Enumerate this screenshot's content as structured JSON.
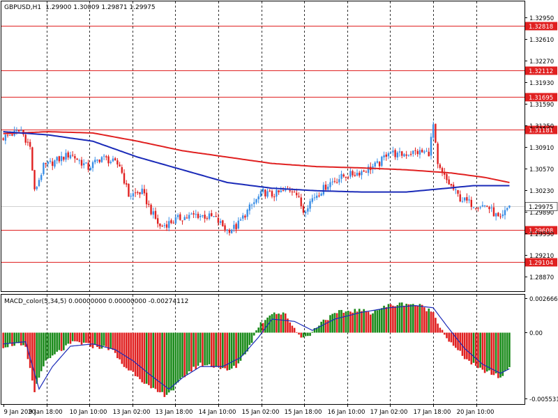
{
  "header": {
    "symbol": "GBPUSD,H1",
    "ohlc": "1.29900 1.30009 1.29871 1.29975"
  },
  "colors": {
    "bull": "#3a8ee6",
    "bear": "#e02020",
    "ma_slow": "#e02020",
    "ma_fast": "#1a2ab8",
    "hline": "#e02020",
    "macd_up": "#1a8a1a",
    "macd_down": "#e02020",
    "signal": "#1a2ab8",
    "grid": "#000000"
  },
  "price_axis": {
    "min": 1.2866,
    "max": 1.3318,
    "ticks": [
      "1.32950",
      "1.32610",
      "1.32270",
      "1.31930",
      "1.31590",
      "1.31250",
      "1.30910",
      "1.30570",
      "1.30230",
      "1.29890",
      "1.29550",
      "1.29210",
      "1.28870"
    ],
    "current_price": "1.29975",
    "horizontal_levels": [
      "1.32818",
      "1.32112",
      "1.31695",
      "1.31181",
      "1.29608",
      "1.29104"
    ]
  },
  "macd": {
    "title": "MACD_color(5,34,5) 0.00000000 0.00000000 -0.00274112",
    "min": -0.0062,
    "max": 0.0033,
    "ticks": [
      "0.0026667",
      "0.00",
      "-0.005531"
    ]
  },
  "time_labels": [
    "9 Jan 2020",
    "9 Jan 18:00",
    "10 Jan 10:00",
    "13 Jan 02:00",
    "13 Jan 18:00",
    "14 Jan 10:00",
    "15 Jan 02:00",
    "15 Jan 18:00",
    "16 Jan 10:00",
    "17 Jan 02:00",
    "17 Jan 18:00",
    "20 Jan 10:00"
  ],
  "chart_data": {
    "type": "candlestick",
    "symbol": "GBPUSD",
    "timeframe": "H1",
    "close_anchors": [
      [
        0,
        1.3106
      ],
      [
        8,
        1.3117
      ],
      [
        12,
        1.309
      ],
      [
        14,
        1.302
      ],
      [
        18,
        1.306
      ],
      [
        30,
        1.308
      ],
      [
        38,
        1.3058
      ],
      [
        44,
        1.3075
      ],
      [
        52,
        1.3062
      ],
      [
        56,
        1.3015
      ],
      [
        62,
        1.302
      ],
      [
        66,
        1.299
      ],
      [
        70,
        1.2965
      ],
      [
        78,
        1.2978
      ],
      [
        86,
        1.2984
      ],
      [
        94,
        1.298
      ],
      [
        100,
        1.296
      ],
      [
        104,
        1.2965
      ],
      [
        110,
        1.2995
      ],
      [
        116,
        1.302
      ],
      [
        120,
        1.3015
      ],
      [
        126,
        1.3022
      ],
      [
        130,
        1.3025
      ],
      [
        134,
        1.299
      ],
      [
        138,
        1.301
      ],
      [
        146,
        1.3035
      ],
      [
        152,
        1.3045
      ],
      [
        158,
        1.305
      ],
      [
        162,
        1.3055
      ],
      [
        168,
        1.3065
      ],
      [
        172,
        1.3085
      ],
      [
        176,
        1.3078
      ],
      [
        184,
        1.3083
      ],
      [
        190,
        1.3082
      ],
      [
        192,
        1.3125
      ],
      [
        194,
        1.306
      ],
      [
        198,
        1.3038
      ],
      [
        204,
        1.301
      ],
      [
        210,
        1.3
      ],
      [
        216,
        1.2998
      ],
      [
        222,
        1.2975
      ],
      [
        226,
        1.3
      ]
    ],
    "ma_slow_anchors": [
      [
        0,
        1.3112
      ],
      [
        20,
        1.3115
      ],
      [
        40,
        1.3113
      ],
      [
        60,
        1.31
      ],
      [
        80,
        1.3085
      ],
      [
        100,
        1.3075
      ],
      [
        120,
        1.3065
      ],
      [
        140,
        1.306
      ],
      [
        160,
        1.3058
      ],
      [
        180,
        1.3055
      ],
      [
        200,
        1.305
      ],
      [
        215,
        1.3043
      ],
      [
        226,
        1.3035
      ]
    ],
    "ma_fast_anchors": [
      [
        0,
        1.3115
      ],
      [
        20,
        1.311
      ],
      [
        40,
        1.31
      ],
      [
        60,
        1.3075
      ],
      [
        80,
        1.3055
      ],
      [
        100,
        1.3035
      ],
      [
        120,
        1.3026
      ],
      [
        140,
        1.3022
      ],
      [
        160,
        1.302
      ],
      [
        180,
        1.302
      ],
      [
        195,
        1.3025
      ],
      [
        210,
        1.303
      ],
      [
        226,
        1.303
      ]
    ],
    "macd_anchors": [
      [
        0,
        -0.0012
      ],
      [
        6,
        -0.001
      ],
      [
        10,
        -0.0014
      ],
      [
        14,
        -0.0052
      ],
      [
        18,
        -0.0028
      ],
      [
        24,
        -0.0018
      ],
      [
        32,
        -0.0008
      ],
      [
        40,
        -0.0012
      ],
      [
        48,
        -0.0014
      ],
      [
        54,
        -0.003
      ],
      [
        60,
        -0.0038
      ],
      [
        66,
        -0.005
      ],
      [
        72,
        -0.0055
      ],
      [
        76,
        -0.005
      ],
      [
        82,
        -0.0036
      ],
      [
        88,
        -0.0028
      ],
      [
        96,
        -0.003
      ],
      [
        100,
        -0.0034
      ],
      [
        104,
        -0.003
      ],
      [
        110,
        -0.0012
      ],
      [
        114,
        0.0006
      ],
      [
        120,
        0.0018
      ],
      [
        126,
        0.0016
      ],
      [
        132,
        -0.0002
      ],
      [
        136,
        -0.0004
      ],
      [
        142,
        0.001
      ],
      [
        150,
        0.0018
      ],
      [
        158,
        0.002
      ],
      [
        164,
        0.0018
      ],
      [
        172,
        0.0024
      ],
      [
        180,
        0.0026
      ],
      [
        186,
        0.0024
      ],
      [
        192,
        0.0018
      ],
      [
        196,
        0.0002
      ],
      [
        200,
        -0.001
      ],
      [
        206,
        -0.0022
      ],
      [
        212,
        -0.0032
      ],
      [
        218,
        -0.0036
      ],
      [
        222,
        -0.004
      ],
      [
        226,
        -0.003
      ]
    ],
    "signal_anchors": [
      [
        0,
        -0.001
      ],
      [
        10,
        -0.0008
      ],
      [
        16,
        -0.005
      ],
      [
        22,
        -0.003
      ],
      [
        30,
        -0.0012
      ],
      [
        40,
        -0.001
      ],
      [
        50,
        -0.0015
      ],
      [
        58,
        -0.0025
      ],
      [
        66,
        -0.0038
      ],
      [
        74,
        -0.005
      ],
      [
        80,
        -0.004
      ],
      [
        88,
        -0.003
      ],
      [
        98,
        -0.003
      ],
      [
        106,
        -0.0022
      ],
      [
        114,
        -0.0004
      ],
      [
        120,
        0.0012
      ],
      [
        130,
        0.001
      ],
      [
        138,
        0.0002
      ],
      [
        148,
        0.0012
      ],
      [
        160,
        0.0018
      ],
      [
        172,
        0.0022
      ],
      [
        184,
        0.0024
      ],
      [
        192,
        0.0022
      ],
      [
        198,
        0.0006
      ],
      [
        206,
        -0.0014
      ],
      [
        214,
        -0.0028
      ],
      [
        222,
        -0.0036
      ],
      [
        226,
        -0.0032
      ]
    ]
  }
}
